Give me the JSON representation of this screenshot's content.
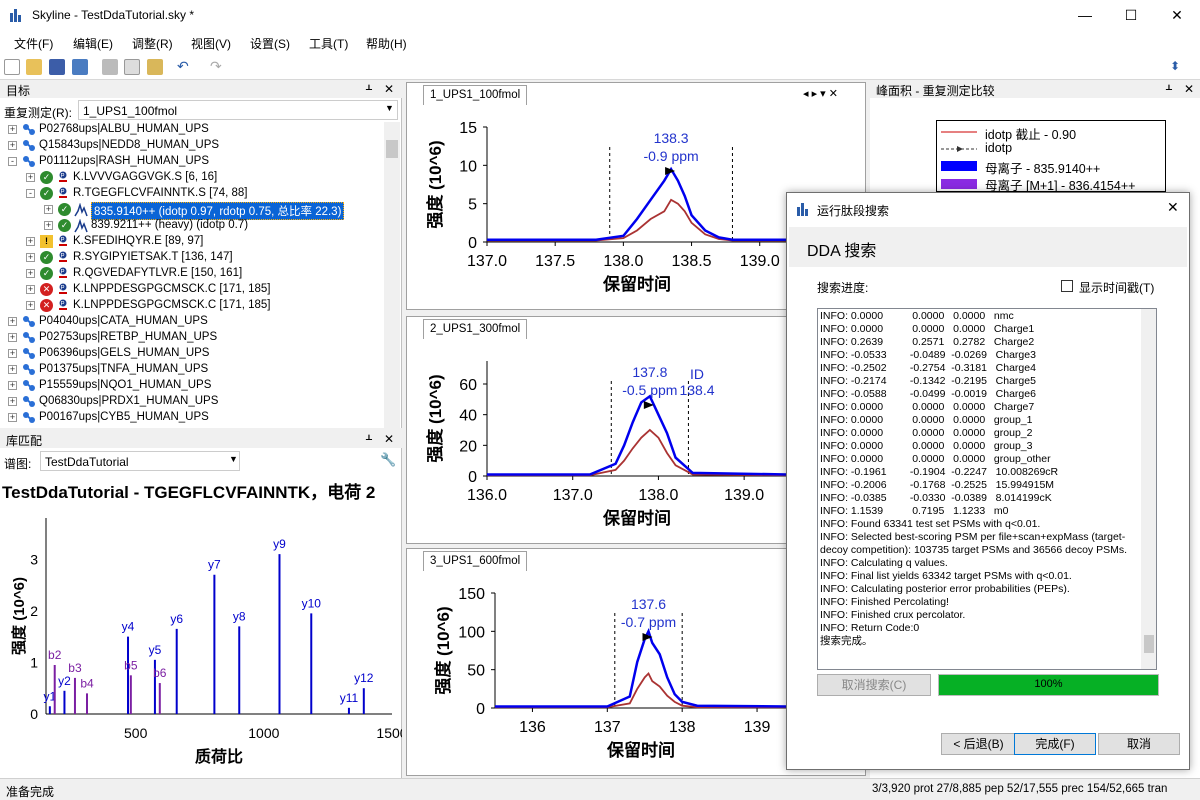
{
  "window": {
    "title": "Skyline - TestDdaTutorial.sky *",
    "minimize": "—",
    "maximize": "☐",
    "close": "✕"
  },
  "menu": [
    "文件(F)",
    "编辑(E)",
    "调整(R)",
    "视图(V)",
    "设置(S)",
    "工具(T)",
    "帮助(H)"
  ],
  "targets": {
    "title": "目标",
    "pin": "ᚆ",
    "close": "✕",
    "replicate_label": "重复测定(R):",
    "replicate_value": "1_UPS1_100fmol",
    "rows": [
      {
        "text": "P02768ups|ALBU_HUMAN_UPS",
        "level": 0,
        "pm": "+",
        "kind": "protein"
      },
      {
        "text": "Q15843ups|NEDD8_HUMAN_UPS",
        "level": 0,
        "pm": "+",
        "kind": "protein"
      },
      {
        "text": "P01112ups|RASH_HUMAN_UPS",
        "level": 0,
        "pm": "-",
        "kind": "protein"
      },
      {
        "text": "K.LVVVGAGGVGK.S [6, 16]",
        "level": 1,
        "pm": "+",
        "kind": "peptide",
        "status": "ok"
      },
      {
        "text": "R.TGEGFLCVFAINNTK.S [74, 88]",
        "level": 1,
        "pm": "-",
        "kind": "peptide",
        "status": "ok"
      },
      {
        "text": "835.9140++ (idotp 0.97, rdotp 0.75, 总比率 22.3)",
        "level": 2,
        "pm": "+",
        "kind": "precursor",
        "status": "ok",
        "selected": true
      },
      {
        "text": "839.9211++ (heavy) (idotp 0.7)",
        "level": 2,
        "pm": "+",
        "kind": "precursor",
        "status": "ok"
      },
      {
        "text": "K.SFEDIHQYR.E [89, 97]",
        "level": 1,
        "pm": "+",
        "kind": "peptide",
        "status": "warn"
      },
      {
        "text": "R.SYGIPYIETSAK.T [136, 147]",
        "level": 1,
        "pm": "+",
        "kind": "peptide",
        "status": "ok"
      },
      {
        "text": "R.QGVEDAFYTLVR.E [150, 161]",
        "level": 1,
        "pm": "+",
        "kind": "peptide",
        "status": "ok"
      },
      {
        "text": "K.LNPPDESGPGCMSCK.C [171, 185]",
        "level": 1,
        "pm": "+",
        "kind": "peptide",
        "status": "err"
      },
      {
        "text": "K.LNPPDESGPGCMSCK.C [171, 185]",
        "level": 1,
        "pm": "+",
        "kind": "peptide",
        "status": "err"
      },
      {
        "text": "P04040ups|CATA_HUMAN_UPS",
        "level": 0,
        "pm": "+",
        "kind": "protein"
      },
      {
        "text": "P02753ups|RETBP_HUMAN_UPS",
        "level": 0,
        "pm": "+",
        "kind": "protein"
      },
      {
        "text": "P06396ups|GELS_HUMAN_UPS",
        "level": 0,
        "pm": "+",
        "kind": "protein"
      },
      {
        "text": "P01375ups|TNFA_HUMAN_UPS",
        "level": 0,
        "pm": "+",
        "kind": "protein"
      },
      {
        "text": "P15559ups|NQO1_HUMAN_UPS",
        "level": 0,
        "pm": "+",
        "kind": "protein"
      },
      {
        "text": "Q06830ups|PRDX1_HUMAN_UPS",
        "level": 0,
        "pm": "+",
        "kind": "protein"
      },
      {
        "text": "P00167ups|CYB5_HUMAN_UPS",
        "level": 0,
        "pm": "+",
        "kind": "protein"
      }
    ]
  },
  "library": {
    "title": "库匹配",
    "pin": "ᚆ",
    "close": "✕",
    "spectrum_label": "谱图:",
    "spectrum_value": "TestDdaTutorial",
    "wrench": "🔧",
    "chart_title": "TestDdaTutorial - TGEGFLCVFAINNTK，电荷 2"
  },
  "graphs": [
    {
      "tab": "1_UPS1_100fmol",
      "annotation": [
        "138.3",
        "-0.9 ppm"
      ]
    },
    {
      "tab": "2_UPS1_300fmol",
      "annotation": [
        "137.8",
        "-0.5 ppm"
      ],
      "extra": [
        "ID",
        "138.4"
      ]
    },
    {
      "tab": "3_UPS1_600fmol",
      "annotation": [
        "137.6",
        "-0.7 ppm"
      ]
    }
  ],
  "tab_nav": "◂ ▸ ▾ ✕",
  "peak_panel": {
    "title": "峰面积 - 重复测定比较",
    "pin": "ᚆ",
    "close": "✕",
    "legend": [
      "idotp 截止 - 0.90",
      "idotp",
      "母离子 - 835.9140++",
      "母离子 [M+1] - 836.4154++"
    ]
  },
  "dialog": {
    "title": "运行肽段搜索",
    "close": "✕",
    "heading": "DDA 搜索",
    "progress_label": "搜索进度:",
    "timestamp_label": "显示时间戳(T)",
    "log": [
      "INFO: 0.0000          0.0000   0.0000   nmc",
      "INFO: 0.0000          0.0000   0.0000   Charge1",
      "INFO: 0.2639          0.2571   0.2782   Charge2",
      "INFO: -0.0533        -0.0489  -0.0269   Charge3",
      "INFO: -0.2502        -0.2754  -0.3181   Charge4",
      "INFO: -0.2174        -0.1342  -0.2195   Charge5",
      "INFO: -0.0588        -0.0499  -0.0019   Charge6",
      "INFO: 0.0000          0.0000   0.0000   Charge7",
      "INFO: 0.0000          0.0000   0.0000   group_1",
      "INFO: 0.0000          0.0000   0.0000   group_2",
      "INFO: 0.0000          0.0000   0.0000   group_3",
      "INFO: 0.0000          0.0000   0.0000   group_other",
      "INFO: -0.1961        -0.1904  -0.2247   10.008269cR",
      "INFO: -0.2006        -0.1768  -0.2525   15.994915M",
      "INFO: -0.0385        -0.0330  -0.0389   8.014199cK",
      "INFO: 1.1539          0.7195   1.1233   m0",
      "INFO: Found 63341 test set PSMs with q<0.01.",
      "INFO: Selected best-scoring PSM per file+scan+expMass (target-",
      "decoy competition): 103735 target PSMs and 36566 decoy PSMs.",
      "INFO: Calculating q values.",
      "INFO: Final list yields 63342 target PSMs with q<0.01.",
      "INFO: Calculating posterior error probabilities (PEPs).",
      "INFO: Finished Percolating!",
      "INFO: Finished crux percolator.",
      "INFO: Return Code:0",
      "搜索完成。"
    ],
    "cancel_search": "取消搜索(C)",
    "progress": "100%",
    "progress_value": 1.0,
    "back": "< 后退(B)",
    "finish": "完成(F)",
    "cancel": "取消"
  },
  "status": {
    "left": "准备完成",
    "right": "3/3,920 prot   27/8,885 pep   52/17,555 prec   154/52,665 tran"
  },
  "chart_data": [
    {
      "type": "line",
      "title": "1_UPS1_100fmol",
      "xlabel": "保留时间",
      "ylabel": "强度 (10^6)",
      "xlim": [
        137,
        139.2
      ],
      "ylim": [
        0,
        15
      ],
      "xticks": [
        137.0,
        137.5,
        138.0,
        138.5,
        139.0
      ],
      "yticks": [
        0,
        5,
        10,
        15
      ],
      "series": [
        {
          "color": "#0000ee",
          "x": [
            137.0,
            137.8,
            138.0,
            138.1,
            138.2,
            138.3,
            138.35,
            138.4,
            138.45,
            138.5,
            138.6,
            138.7,
            138.8,
            139.2
          ],
          "y": [
            0.3,
            0.3,
            0.8,
            3,
            5.5,
            8,
            9.5,
            8,
            6,
            3.5,
            1.5,
            0.6,
            0.3,
            0.3
          ]
        },
        {
          "color": "#aa3333",
          "x": [
            137.0,
            137.8,
            138.0,
            138.1,
            138.2,
            138.3,
            138.35,
            138.4,
            138.45,
            138.5,
            138.6,
            138.7,
            138.8,
            139.2
          ],
          "y": [
            0.2,
            0.2,
            0.5,
            1.5,
            3,
            4,
            5.5,
            5,
            4,
            2.5,
            1,
            0.4,
            0.2,
            0.2
          ]
        }
      ]
    },
    {
      "type": "line",
      "title": "2_UPS1_300fmol",
      "xlabel": "保留时间",
      "ylabel": "强度 (10^6)",
      "xlim": [
        136,
        139.5
      ],
      "ylim": [
        0,
        75
      ],
      "xticks": [
        136.0,
        137.0,
        138.0,
        139.0
      ],
      "yticks": [
        0,
        20,
        40,
        60
      ],
      "series": [
        {
          "color": "#0000ee",
          "x": [
            136.0,
            137.2,
            137.5,
            137.6,
            137.7,
            137.8,
            137.9,
            138.0,
            138.1,
            138.2,
            138.4,
            139.5
          ],
          "y": [
            1,
            1,
            8,
            20,
            35,
            48,
            52,
            40,
            28,
            12,
            2,
            1
          ]
        },
        {
          "color": "#aa3333",
          "x": [
            136.0,
            137.2,
            137.5,
            137.6,
            137.7,
            137.8,
            137.9,
            138.0,
            138.1,
            138.2,
            138.4,
            139.5
          ],
          "y": [
            0.5,
            0.5,
            4,
            10,
            18,
            25,
            30,
            25,
            15,
            7,
            1,
            0.5
          ]
        }
      ]
    },
    {
      "type": "line",
      "title": "3_UPS1_600fmol",
      "xlabel": "保留时间",
      "ylabel": "强度 (10^6)",
      "xlim": [
        135.5,
        139.4
      ],
      "ylim": [
        0,
        150
      ],
      "xticks": [
        136,
        137,
        138,
        139
      ],
      "yticks": [
        0,
        50,
        100,
        150
      ],
      "series": [
        {
          "color": "#0000ee",
          "x": [
            135.5,
            137.0,
            137.3,
            137.4,
            137.5,
            137.55,
            137.6,
            137.7,
            137.8,
            137.9,
            138.0,
            138.2,
            139.4
          ],
          "y": [
            2,
            2,
            15,
            60,
            90,
            100,
            85,
            70,
            40,
            18,
            8,
            3,
            2
          ]
        },
        {
          "color": "#aa3333",
          "x": [
            135.5,
            137.0,
            137.3,
            137.4,
            137.5,
            137.55,
            137.6,
            137.7,
            137.8,
            137.9,
            138.0,
            138.2,
            139.4
          ],
          "y": [
            1,
            1,
            6,
            25,
            40,
            45,
            35,
            28,
            16,
            8,
            3,
            1,
            1
          ]
        }
      ]
    },
    {
      "type": "bar",
      "title": "TestDdaTutorial - TGEGFLCVFAINNTK，电荷 2",
      "xlabel": "质荷比",
      "ylabel": "强度 (10^6)",
      "xlim": [
        150,
        1500
      ],
      "ylim": [
        0,
        3.8
      ],
      "xticks": [
        500,
        1000,
        1500
      ],
      "yticks": [
        0,
        1,
        2,
        3
      ],
      "peaks": [
        {
          "mz": 165,
          "y": 0.15,
          "label": "y1",
          "color": "#0000cc"
        },
        {
          "mz": 184,
          "y": 0.95,
          "label": "b2",
          "color": "#7b1fa2"
        },
        {
          "mz": 222,
          "y": 0.45,
          "label": "y2",
          "color": "#0000cc"
        },
        {
          "mz": 263,
          "y": 0.7,
          "label": "b3",
          "color": "#7b1fa2"
        },
        {
          "mz": 310,
          "y": 0.4,
          "label": "b4",
          "color": "#7b1fa2"
        },
        {
          "mz": 470,
          "y": 1.5,
          "label": "y4",
          "color": "#0000cc"
        },
        {
          "mz": 481,
          "y": 0.75,
          "label": "b5",
          "color": "#7b1fa2"
        },
        {
          "mz": 575,
          "y": 1.05,
          "label": "y5",
          "color": "#0000cc"
        },
        {
          "mz": 594,
          "y": 0.6,
          "label": "b6",
          "color": "#7b1fa2"
        },
        {
          "mz": 660,
          "y": 1.65,
          "label": "y6",
          "color": "#0000cc"
        },
        {
          "mz": 807,
          "y": 2.7,
          "label": "y7",
          "color": "#0000cc"
        },
        {
          "mz": 904,
          "y": 1.7,
          "label": "y8",
          "color": "#0000cc"
        },
        {
          "mz": 1061,
          "y": 3.1,
          "label": "y9",
          "color": "#0000cc"
        },
        {
          "mz": 1185,
          "y": 1.95,
          "label": "y10",
          "color": "#0000cc"
        },
        {
          "mz": 1332,
          "y": 0.12,
          "label": "y11",
          "color": "#0000cc"
        },
        {
          "mz": 1390,
          "y": 0.5,
          "label": "y12",
          "color": "#0000cc"
        }
      ]
    }
  ]
}
